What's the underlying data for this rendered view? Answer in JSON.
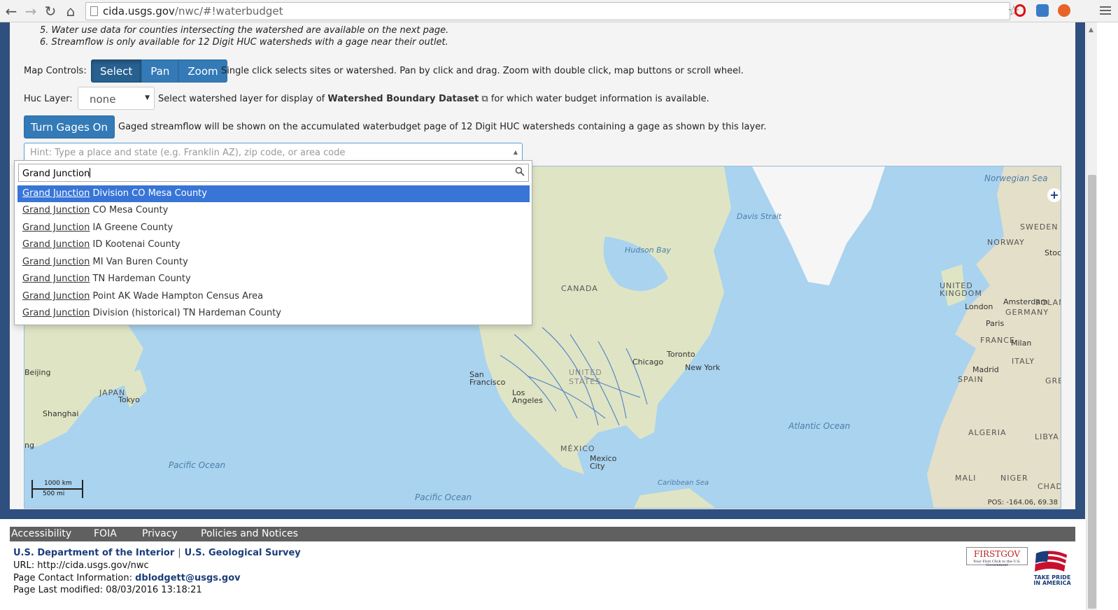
{
  "browser": {
    "url_host": "cida.usgs.gov",
    "url_path": "/nwc/#!waterbudget"
  },
  "notes": [
    "5. Water use data for counties intersecting the watershed are available on the next page.",
    "6. Streamflow is only available for 12 Digit HUC watersheds with a gage near their outlet."
  ],
  "map_controls": {
    "label": "Map Controls:",
    "buttons": [
      "Select",
      "Pan",
      "Zoom"
    ],
    "active": "Select",
    "help": "Single click selects sites or watershed. Pan by click and drag. Zoom with double click, map buttons or scroll wheel."
  },
  "huc_layer": {
    "label": "Huc Layer:",
    "value": "none",
    "help_prefix": "Select watershed layer for display of",
    "link": "Watershed Boundary Dataset",
    "help_suffix": "for which water budget information is available."
  },
  "gages": {
    "button": "Turn Gages On",
    "help": "Gaged streamflow will be shown on the accumulated waterbudget page of 12 Digit HUC watersheds containing a gage as shown by this layer."
  },
  "search": {
    "hint": "Hint: Type a place and state (e.g. Franklin AZ), zip code, or area code",
    "value": "Grand Junction",
    "results": [
      {
        "match": "Grand Junction",
        "rest": " Division CO Mesa County",
        "selected": true
      },
      {
        "match": "Grand Junction",
        "rest": " CO Mesa County",
        "selected": false
      },
      {
        "match": "Grand Junction",
        "rest": " IA Greene County",
        "selected": false
      },
      {
        "match": "Grand Junction",
        "rest": " ID Kootenai County",
        "selected": false
      },
      {
        "match": "Grand Junction",
        "rest": " MI Van Buren County",
        "selected": false
      },
      {
        "match": "Grand Junction",
        "rest": " TN Hardeman County",
        "selected": false
      },
      {
        "match": "Grand Junction",
        "rest": " Point AK Wade Hampton Census Area",
        "selected": false
      },
      {
        "match": "Grand Junction",
        "rest": " Division (historical) TN Hardeman County",
        "selected": false
      }
    ]
  },
  "map": {
    "labels": {
      "norwegian_sea": "Norwegian Sea",
      "davis_strait": "Davis Strait",
      "hudson_bay": "Hudson Bay",
      "canada": "CANADA",
      "sweden": "SWEDEN",
      "norway": "NORWAY",
      "stoc": "Stoc",
      "uk": "UNITED KINGDOM",
      "london": "London",
      "amsterdam": "Amsterdam",
      "germany": "GERMANY",
      "polan": "POLAN",
      "paris": "Paris",
      "france": "FRANCE",
      "milan": "Milan",
      "italy": "ITALY",
      "madrid": "Madrid",
      "spain": "SPAIN",
      "gre": "GRE",
      "toronto": "Toronto",
      "chicago": "Chicago",
      "new_york": "New York",
      "united_states": "UNITED STATES",
      "san_francisco": "San Francisco",
      "los_angeles": "Los Angeles",
      "mexico": "MÉXICO",
      "mexico_city": "Mexico City",
      "atlantic": "Atlantic Ocean",
      "caribbean": "Caribbean Sea",
      "algeria": "ALGERIA",
      "libya": "LIBYA",
      "mali": "MALI",
      "niger": "NIGER",
      "chad": "CHAD",
      "beijing": "Beijing",
      "japan": "JAPAN",
      "tokyo": "Tokyo",
      "shanghai": "Shanghai",
      "ng": "ng",
      "pacific_w": "Pacific Ocean",
      "pacific_s": "Pacific Ocean"
    },
    "scale_km": "1000 km",
    "scale_mi": "500 mi",
    "position": "POS: -164.06, 69.38"
  },
  "footer": {
    "links": [
      "Accessibility",
      "FOIA",
      "Privacy",
      "Policies and Notices"
    ],
    "doi": "U.S. Department of the Interior",
    "usgs": "U.S. Geological Survey",
    "sep": "|",
    "url_line": "URL: http://cida.usgs.gov/nwc",
    "contact_label": "Page Contact Information:",
    "contact_email": "dblodgett@usgs.gov",
    "modified": "Page Last modified: 08/03/2016 13:18:21",
    "firstgov": "FIRSTGOV",
    "firstgov_sub": "Your First Click to the U.S. Government",
    "pride": "TAKE PRIDE IN AMERICA"
  },
  "colors": {
    "primary_button": "#337ab7",
    "frame": "#2f4f7e",
    "highlight": "#3875d7"
  }
}
